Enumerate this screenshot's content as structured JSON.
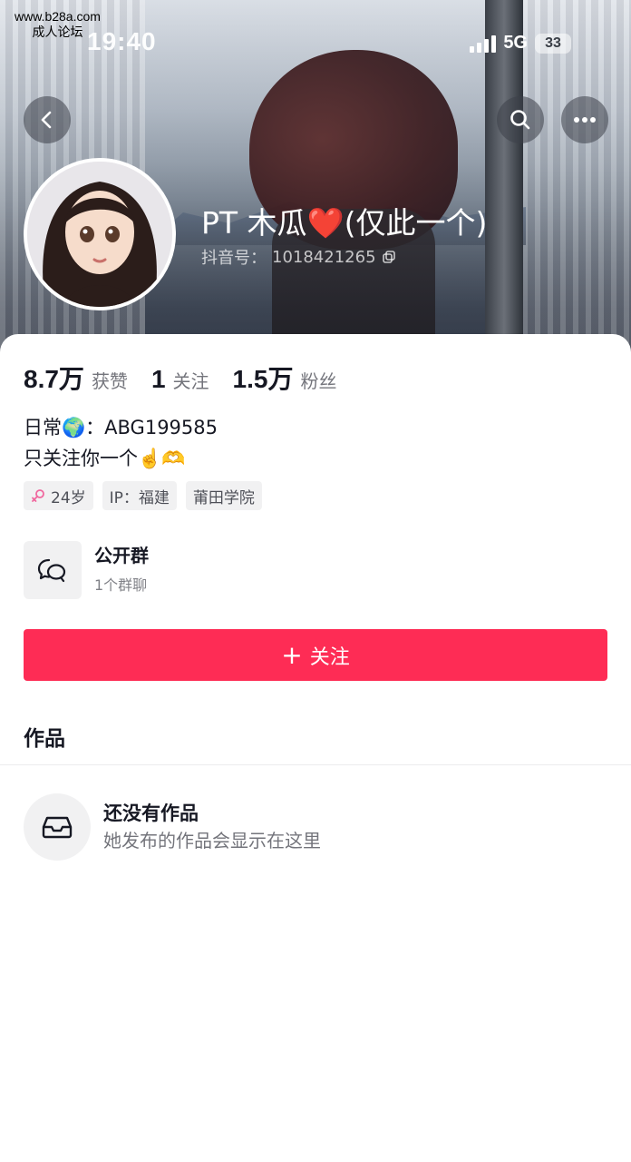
{
  "watermark": {
    "line1": "www.b28a.com",
    "line2": "成人论坛"
  },
  "status_bar": {
    "time": "19:40",
    "network": "5G",
    "battery": "33"
  },
  "header": {
    "nickname": "PT 木瓜",
    "nickname_emoji": "❤️",
    "nickname_suffix": "(仅此一个)",
    "douyin_id_label": "抖音号：",
    "douyin_id": "1018421265"
  },
  "stats": [
    {
      "value": "8.7万",
      "label": "获赞"
    },
    {
      "value": "1",
      "label": "关注"
    },
    {
      "value": "1.5万",
      "label": "粉丝"
    }
  ],
  "bio": {
    "line1_prefix": "日常",
    "line1_emoji": "🌍",
    "line1_suffix": "：ABG199585",
    "line2_text": "只关注你一个",
    "line2_emoji": "☝️🫶"
  },
  "tags": [
    {
      "icon": "female-icon",
      "label": "24岁"
    },
    {
      "label": "IP：福建"
    },
    {
      "label": "莆田学院"
    }
  ],
  "group": {
    "title": "公开群",
    "subtitle": "1个群聊"
  },
  "follow_button": {
    "plus": "+",
    "label": "关注"
  },
  "works": {
    "title": "作品"
  },
  "empty_state": {
    "title": "还没有作品",
    "subtitle": "她发布的作品会显示在这里"
  },
  "colors": {
    "accent": "#fe2c55",
    "text": "#161823"
  }
}
